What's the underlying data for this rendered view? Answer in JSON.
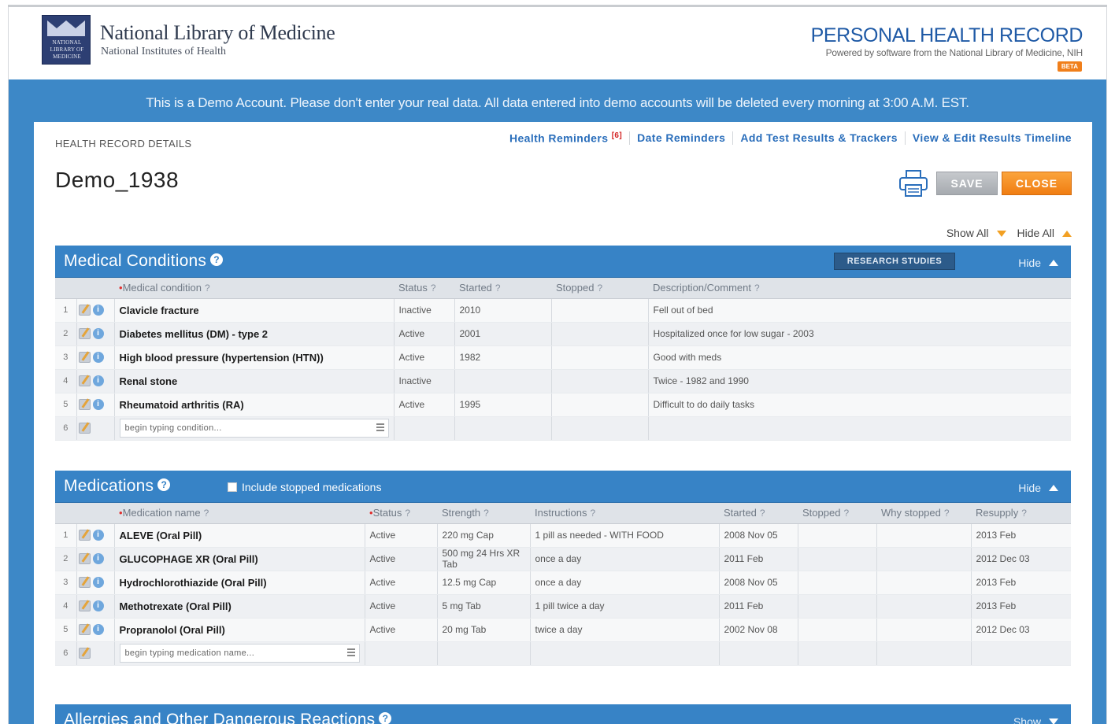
{
  "header": {
    "org_name": "National Library of Medicine",
    "org_sub": "National Institutes of Health",
    "logo_text": "NATIONAL LIBRARY OF MEDICINE",
    "app_title": "PERSONAL HEALTH RECORD",
    "app_sub": "Powered by software from the National Library of Medicine, NIH",
    "beta": "BETA"
  },
  "notice": "This is a Demo Account. Please don't enter your real data. All data entered into demo accounts will be deleted every morning at 3:00 A.M. EST.",
  "record": {
    "section_label": "HEALTH RECORD DETAILS",
    "patient_name": "Demo_1938",
    "links": {
      "health_reminders": "Health Reminders",
      "health_reminders_count": "[6]",
      "date_reminders": "Date Reminders",
      "add_test_results": "Add Test Results & Trackers",
      "view_timeline": "View & Edit Results Timeline"
    },
    "save": "SAVE",
    "close": "CLOSE",
    "show_all": "Show All",
    "hide_all": "Hide All"
  },
  "conditions": {
    "title": "Medical Conditions",
    "research_btn": "RESEARCH STUDIES",
    "hide": "Hide",
    "columns": {
      "condition": "Medical condition",
      "status": "Status",
      "started": "Started",
      "stopped": "Stopped",
      "comment": "Description/Comment"
    },
    "rows": [
      {
        "num": "1",
        "name": "Clavicle fracture",
        "status": "Inactive",
        "started": "2010",
        "stopped": "",
        "comment": "Fell out of bed"
      },
      {
        "num": "2",
        "name": "Diabetes mellitus (DM) - type 2",
        "status": "Active",
        "started": "2001",
        "stopped": "",
        "comment": "Hospitalized once for low sugar - 2003"
      },
      {
        "num": "3",
        "name": "High blood pressure (hypertension (HTN))",
        "status": "Active",
        "started": "1982",
        "stopped": "",
        "comment": "Good with meds"
      },
      {
        "num": "4",
        "name": "Renal stone",
        "status": "Inactive",
        "started": "",
        "stopped": "",
        "comment": "Twice - 1982 and 1990"
      },
      {
        "num": "5",
        "name": "Rheumatoid arthritis (RA)",
        "status": "Active",
        "started": "1995",
        "stopped": "",
        "comment": "Difficult to do daily tasks"
      }
    ],
    "new_row_num": "6",
    "placeholder": "begin typing condition..."
  },
  "medications": {
    "title": "Medications",
    "include_stopped": "Include stopped medications",
    "hide": "Hide",
    "columns": {
      "name": "Medication name",
      "status": "Status",
      "strength": "Strength",
      "instructions": "Instructions",
      "started": "Started",
      "stopped": "Stopped",
      "why": "Why stopped",
      "resupply": "Resupply"
    },
    "rows": [
      {
        "num": "1",
        "name": "ALEVE (Oral Pill)",
        "status": "Active",
        "strength": "220 mg Cap",
        "instructions": "1 pill as needed - WITH FOOD",
        "started": "2008 Nov 05",
        "stopped": "",
        "why": "",
        "resupply": "2013 Feb"
      },
      {
        "num": "2",
        "name": "GLUCOPHAGE XR (Oral Pill)",
        "status": "Active",
        "strength": "500 mg 24 Hrs XR Tab",
        "instructions": "once a day",
        "started": "2011 Feb",
        "stopped": "",
        "why": "",
        "resupply": "2012 Dec 03"
      },
      {
        "num": "3",
        "name": "Hydrochlorothiazide (Oral Pill)",
        "status": "Active",
        "strength": "12.5 mg Cap",
        "instructions": "once a day",
        "started": "2008 Nov 05",
        "stopped": "",
        "why": "",
        "resupply": "2013 Feb"
      },
      {
        "num": "4",
        "name": "Methotrexate (Oral Pill)",
        "status": "Active",
        "strength": "5 mg Tab",
        "instructions": "1 pill twice a day",
        "started": "2011 Feb",
        "stopped": "",
        "why": "",
        "resupply": "2013 Feb"
      },
      {
        "num": "5",
        "name": "Propranolol (Oral Pill)",
        "status": "Active",
        "strength": "20 mg Tab",
        "instructions": "twice a day",
        "started": "2002 Nov 08",
        "stopped": "",
        "why": "",
        "resupply": "2012 Dec 03"
      }
    ],
    "new_row_num": "6",
    "placeholder": "begin typing medication name..."
  },
  "allergies": {
    "title": "Allergies and Other Dangerous Reactions",
    "show": "Show"
  },
  "colors": {
    "accent_blue": "#3783c6",
    "band_blue": "#3d88c7",
    "orange": "#f07d12",
    "title_blue": "#1f5aa6"
  },
  "icons": [
    "print-icon",
    "help-icon",
    "edit-icon",
    "info-icon",
    "list-icon",
    "arrow-up-icon",
    "arrow-down-icon"
  ]
}
